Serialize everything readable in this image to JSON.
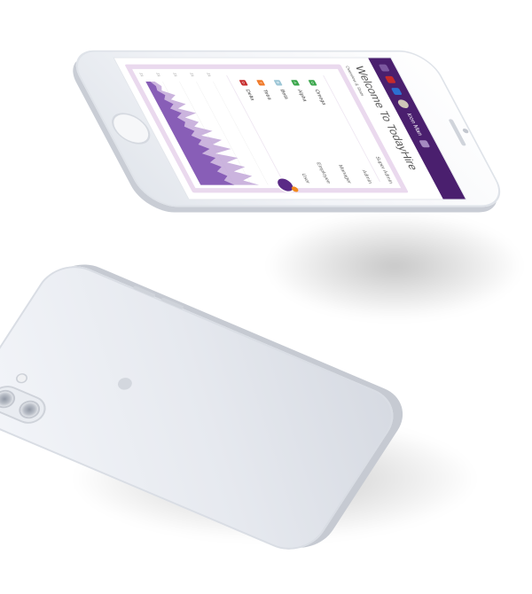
{
  "header": {
    "user_name": "Icon Man"
  },
  "main": {
    "welcome_title": "Welcome To TodayHire",
    "subtitle": "Overview & Stats"
  },
  "roles": [
    "Super Admin",
    "Admin",
    "Manager",
    "Employee",
    "User"
  ],
  "members": [
    {
      "name": "Omega",
      "color": "#3aa64b",
      "letter": "O"
    },
    {
      "name": "Alpha",
      "color": "#3aa64b",
      "letter": "A"
    },
    {
      "name": "Beta",
      "color": "#9cc6d6",
      "letter": "B"
    },
    {
      "name": "Tetra",
      "color": "#f07a2a",
      "letter": "T"
    },
    {
      "name": "Delta",
      "color": "#c62b2b",
      "letter": "D"
    }
  ],
  "chart_data": {
    "type": "area",
    "x": [
      1,
      2,
      3,
      4,
      5,
      6,
      7,
      8,
      9,
      10,
      11,
      12,
      13,
      14,
      15,
      16,
      17,
      18,
      19,
      20,
      21,
      22,
      23,
      24
    ],
    "series": [
      {
        "values": [
          8,
          12,
          10,
          20,
          14,
          25,
          16,
          30,
          18,
          28,
          22,
          36,
          24,
          40,
          30,
          44,
          28,
          46,
          34,
          48,
          36,
          50,
          40,
          52
        ]
      },
      {
        "values": [
          4,
          7,
          6,
          11,
          8,
          14,
          9,
          17,
          11,
          16,
          13,
          20,
          15,
          22,
          17,
          25,
          16,
          26,
          19,
          27,
          21,
          28,
          23,
          30
        ]
      }
    ],
    "ylim": [
      0,
      60
    ],
    "y_ticks": [
      "21",
      "21",
      "21",
      "21",
      "21"
    ],
    "colors": [
      "#b99bd3",
      "#7d4fb0"
    ],
    "grid": true
  }
}
